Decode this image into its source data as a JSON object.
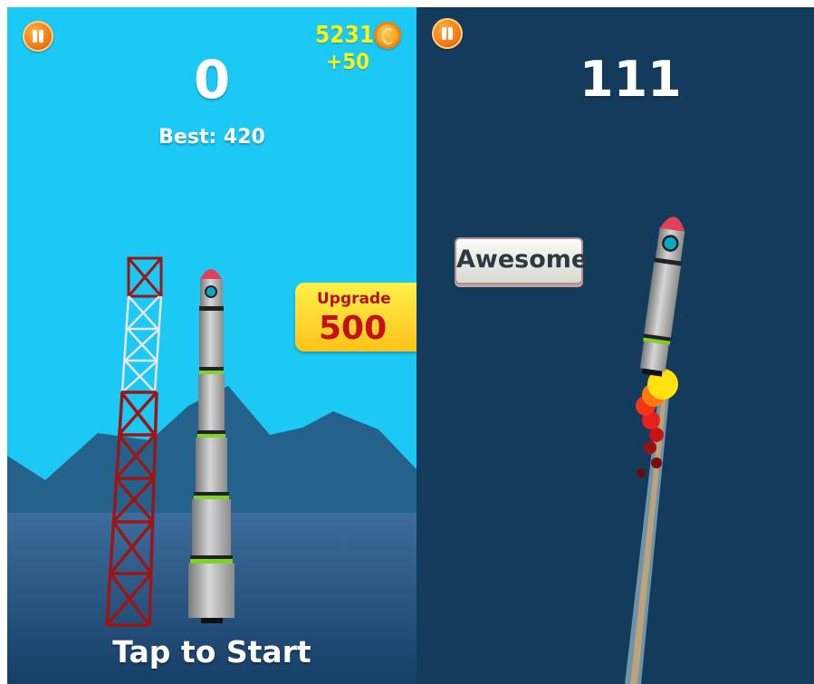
{
  "left_screen": {
    "score": "0",
    "best_label": "Best: 420",
    "coins_total": "5231",
    "coins_gain": "+50",
    "upgrade": {
      "label": "Upgrade",
      "cost": "500"
    },
    "start_prompt": "Tap to Start",
    "icons": {
      "pause": "pause-icon",
      "coin": "coin-icon"
    }
  },
  "right_screen": {
    "score": "111",
    "praise_label": "Awesome",
    "icons": {
      "pause": "pause-icon"
    }
  },
  "colors": {
    "sky_day": "#1cc8f4",
    "sky_night": "#133c5c",
    "mountains": "#24628c",
    "sea": "#2b5d8e",
    "tower": "#9b1616",
    "coin_text": "#f8f21a",
    "upgrade_text": "#c3101a"
  }
}
